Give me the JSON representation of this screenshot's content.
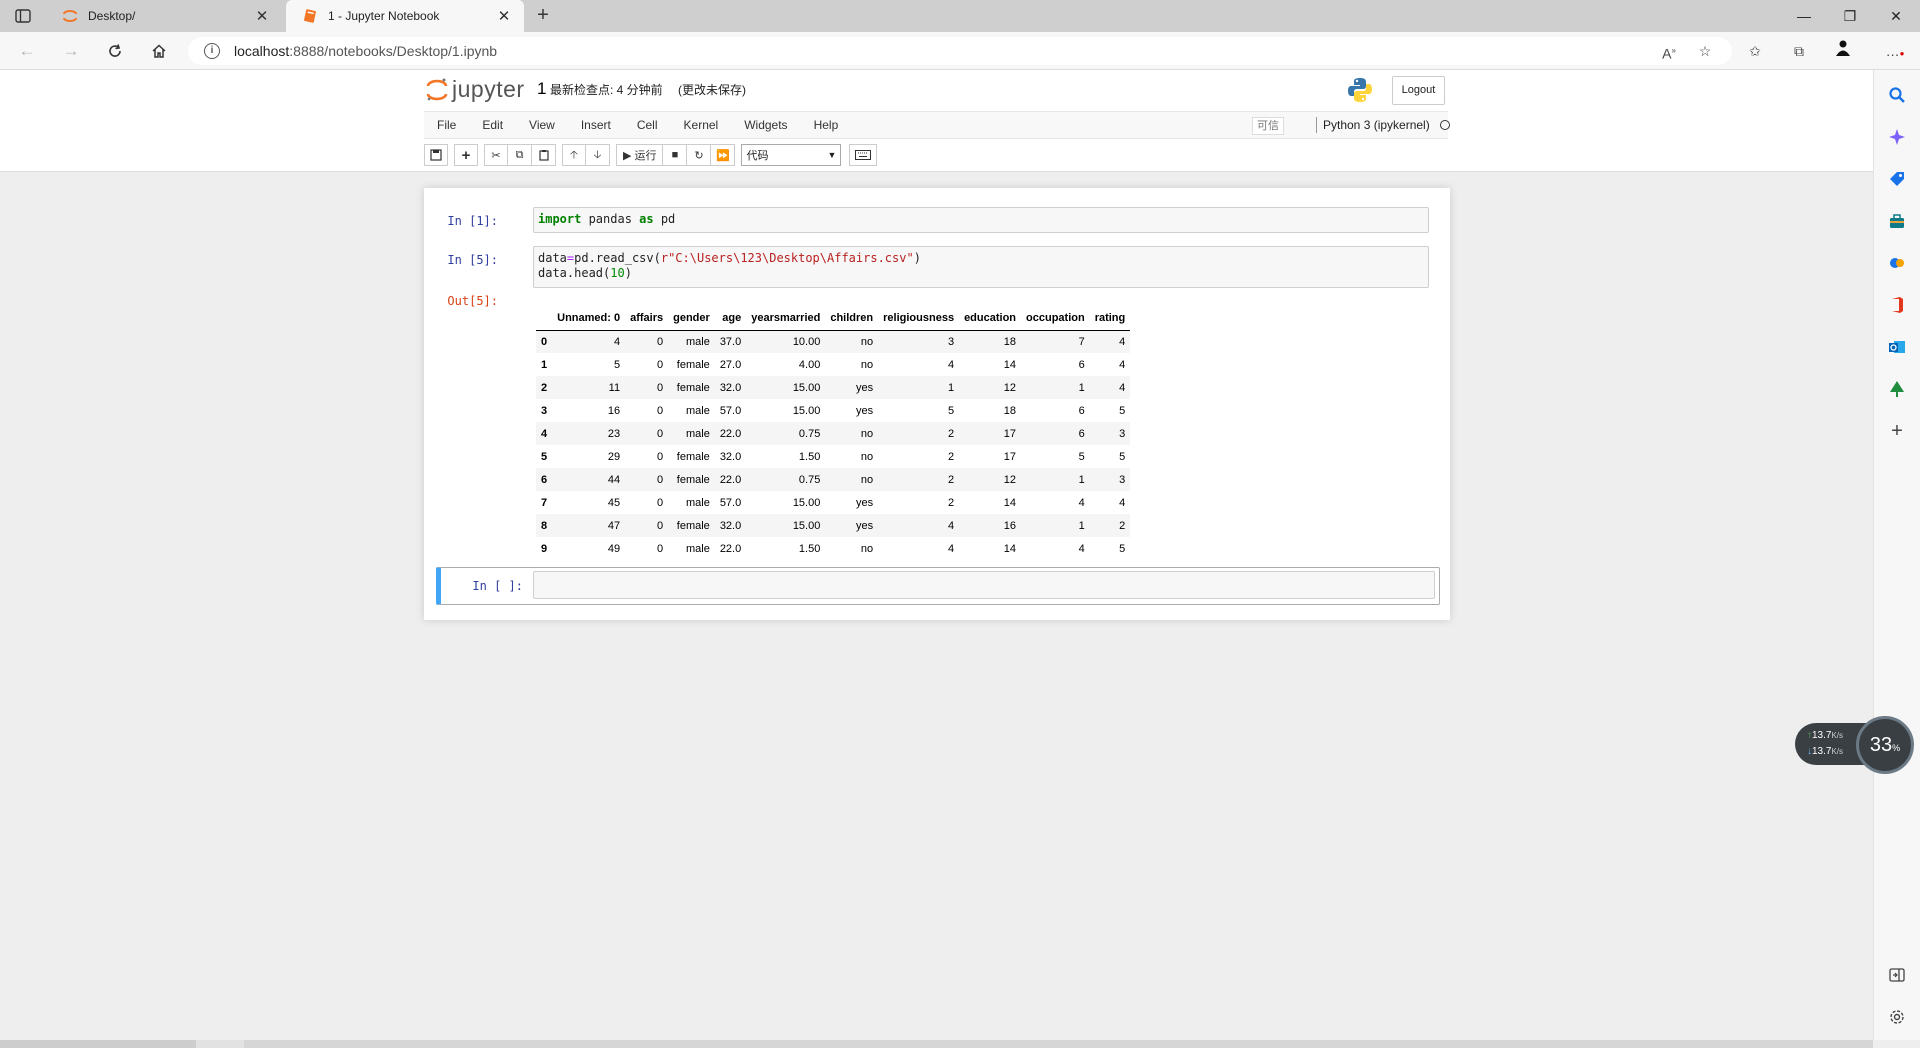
{
  "browser": {
    "tabs": [
      {
        "title": "Desktop/",
        "active": false
      },
      {
        "title": "1 - Jupyter Notebook",
        "active": true
      }
    ],
    "url_host": "localhost",
    "url_rest": ":8888/notebooks/Desktop/1.ipynb",
    "window_controls": {
      "minimize": "—",
      "restore": "❐",
      "close": "✕"
    }
  },
  "jupyter": {
    "logo_text": "jupyter",
    "notebook_name": "1",
    "checkpoint": "最新检查点: 4 分钟前",
    "autosave": "(更改未保存)",
    "logout_label": "Logout",
    "menu": [
      "File",
      "Edit",
      "View",
      "Insert",
      "Cell",
      "Kernel",
      "Widgets",
      "Help"
    ],
    "trusted_label": "可信",
    "kernel_name": "Python 3 (ipykernel)",
    "toolbar": {
      "run_label": "运行",
      "cell_type": "代码"
    }
  },
  "cells": {
    "c1": {
      "prompt": "In  [1]:"
    },
    "c2": {
      "prompt": "In  [5]:"
    },
    "out": {
      "prompt": "Out[5]:"
    },
    "c3": {
      "prompt": "In  [ ]:"
    }
  },
  "code": {
    "c1": {
      "kw1": "import",
      "mid": " pandas ",
      "kw2": "as",
      "end": " pd"
    },
    "c2": {
      "line1_a": "data",
      "line1_eq": "=",
      "line1_b": "pd.read_csv(",
      "line1_str": "r\"C:\\Users\\123\\Desktop\\Affairs.csv\"",
      "line1_c": ")",
      "line2_a": "data.head(",
      "line2_num": "10",
      "line2_c": ")"
    }
  },
  "dataframe": {
    "columns": [
      "",
      "Unnamed: 0",
      "affairs",
      "gender",
      "age",
      "yearsmarried",
      "children",
      "religiousness",
      "education",
      "occupation",
      "rating"
    ],
    "rows": [
      [
        "0",
        "4",
        "0",
        "male",
        "37.0",
        "10.00",
        "no",
        "3",
        "18",
        "7",
        "4"
      ],
      [
        "1",
        "5",
        "0",
        "female",
        "27.0",
        "4.00",
        "no",
        "4",
        "14",
        "6",
        "4"
      ],
      [
        "2",
        "11",
        "0",
        "female",
        "32.0",
        "15.00",
        "yes",
        "1",
        "12",
        "1",
        "4"
      ],
      [
        "3",
        "16",
        "0",
        "male",
        "57.0",
        "15.00",
        "yes",
        "5",
        "18",
        "6",
        "5"
      ],
      [
        "4",
        "23",
        "0",
        "male",
        "22.0",
        "0.75",
        "no",
        "2",
        "17",
        "6",
        "3"
      ],
      [
        "5",
        "29",
        "0",
        "female",
        "32.0",
        "1.50",
        "no",
        "2",
        "17",
        "5",
        "5"
      ],
      [
        "6",
        "44",
        "0",
        "female",
        "22.0",
        "0.75",
        "no",
        "2",
        "12",
        "1",
        "3"
      ],
      [
        "7",
        "45",
        "0",
        "male",
        "57.0",
        "15.00",
        "yes",
        "2",
        "14",
        "4",
        "4"
      ],
      [
        "8",
        "47",
        "0",
        "female",
        "32.0",
        "15.00",
        "yes",
        "4",
        "16",
        "1",
        "2"
      ],
      [
        "9",
        "49",
        "0",
        "male",
        "22.0",
        "1.50",
        "no",
        "4",
        "14",
        "4",
        "5"
      ]
    ]
  },
  "netmon": {
    "up_rate": "13.7",
    "down_rate": "13.7",
    "unit": "K/s",
    "percent": "33",
    "percent_sign": "%"
  },
  "icons": {
    "sidebar": [
      "search-icon",
      "copilot-icon",
      "shopping-tag-icon",
      "toolbox-icon",
      "games-icon",
      "office-icon",
      "outlook-icon",
      "tree-icon",
      "add-icon",
      "split-screen-icon",
      "settings-icon"
    ]
  },
  "colors": {
    "jupyter_orange": "#f37626",
    "selected_cell_bar": "#42a5f5",
    "in_prompt": "#303f9f",
    "out_prompt": "#d84315"
  }
}
